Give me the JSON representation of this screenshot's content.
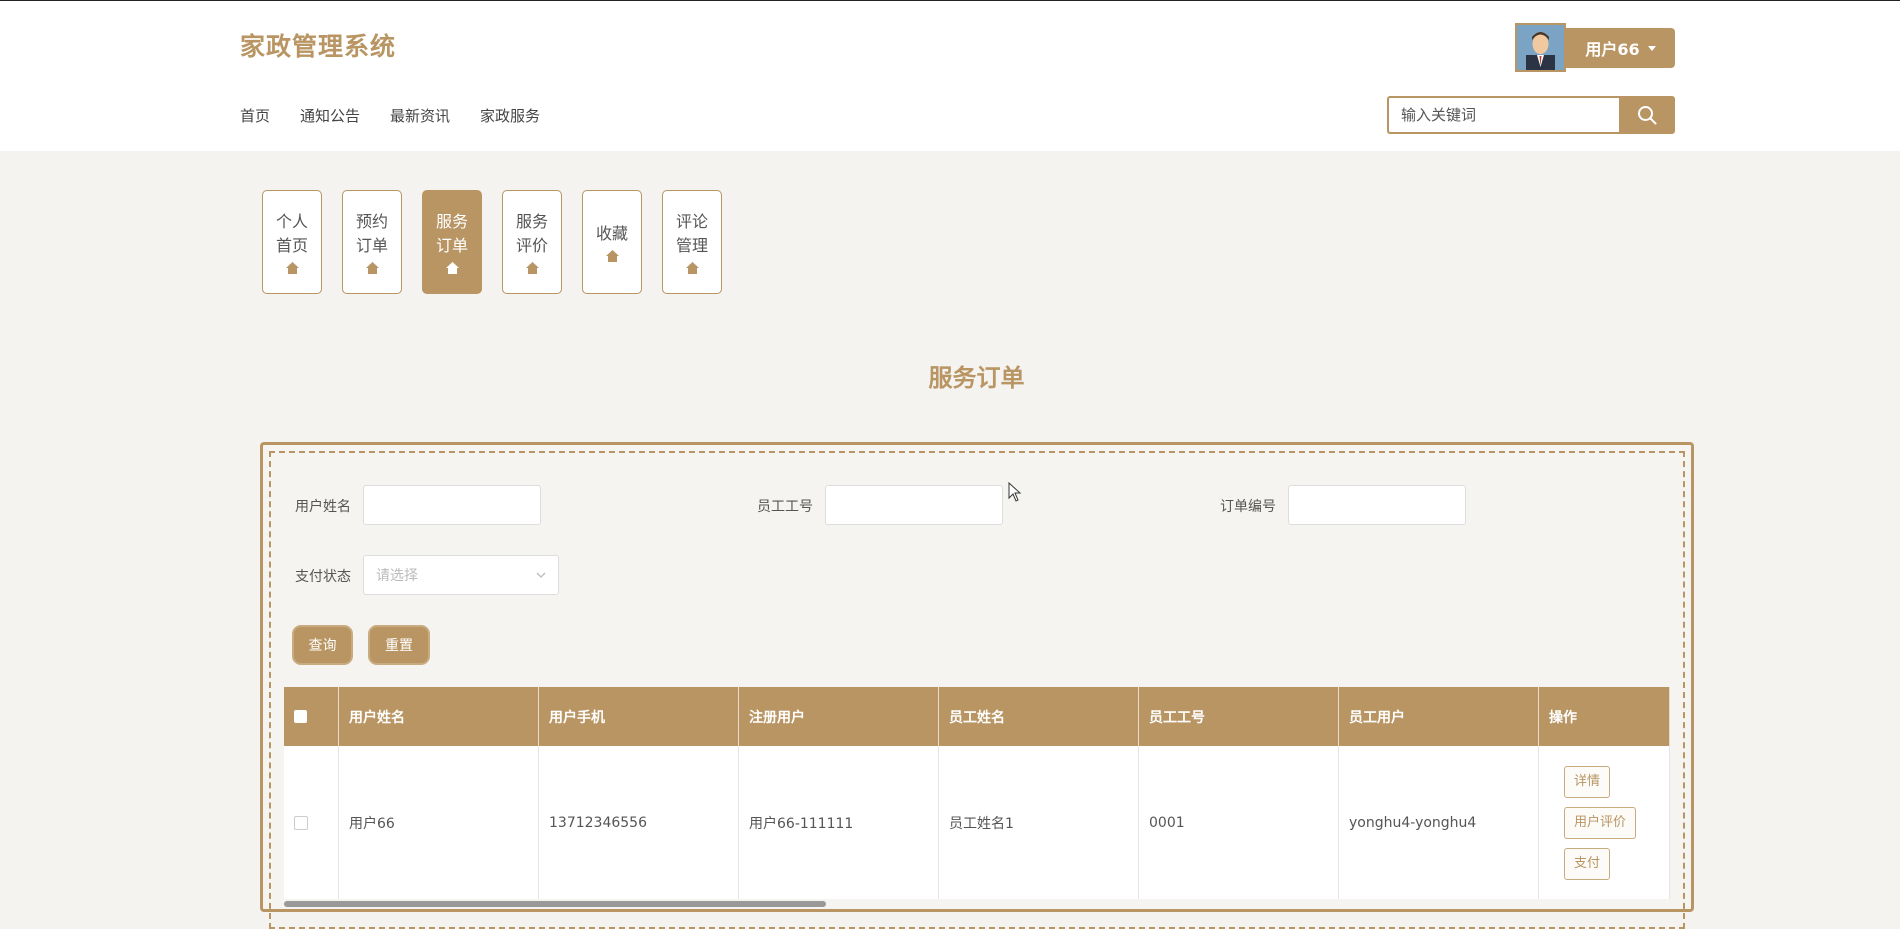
{
  "header": {
    "app_title": "家政管理系统",
    "nav": [
      "首页",
      "通知公告",
      "最新资讯",
      "家政服务"
    ],
    "user": {
      "name": "用户66"
    },
    "search": {
      "placeholder": "输入关键词"
    }
  },
  "tabs": [
    {
      "line1": "个人",
      "line2": "首页",
      "active": false
    },
    {
      "line1": "预约",
      "line2": "订单",
      "active": false
    },
    {
      "line1": "服务",
      "line2": "订单",
      "active": true
    },
    {
      "line1": "服务",
      "line2": "评价",
      "active": false
    },
    {
      "line1": "收藏",
      "line2": "",
      "active": false
    },
    {
      "line1": "评论",
      "line2": "管理",
      "active": false
    }
  ],
  "page_title": "服务订单",
  "filters": {
    "user_name_label": "用户姓名",
    "employee_no_label": "员工工号",
    "order_no_label": "订单编号",
    "pay_status_label": "支付状态",
    "pay_status_placeholder": "请选择",
    "query_label": "查询",
    "reset_label": "重置"
  },
  "table": {
    "columns": [
      "用户姓名",
      "用户手机",
      "注册用户",
      "员工姓名",
      "员工工号",
      "员工用户",
      "操作"
    ],
    "rows": [
      {
        "user_name": "用户66",
        "phone": "13712346556",
        "reg_user": "用户66-111111",
        "emp_name": "员工姓名1",
        "emp_no": "0001",
        "emp_user": "yonghu4-yonghu4",
        "actions": [
          "详情",
          "用户评价",
          "支付"
        ]
      }
    ]
  },
  "colors": {
    "accent": "#b89563",
    "background": "#f4f3ef"
  }
}
